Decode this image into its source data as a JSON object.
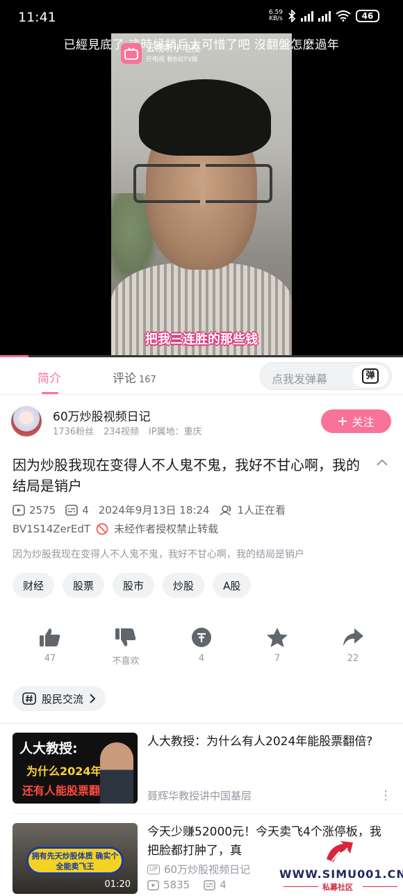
{
  "status_bar": {
    "time": "11:41",
    "net_speed": "6.59",
    "net_unit": "KB/s",
    "battery": "46"
  },
  "player": {
    "scrolling_danmaku": "已經見底了  這時候銷戶太可惜了吧  沒翻盤怎麼過年",
    "tv_badge_title": "云视听小电视",
    "tv_badge_sub": "开电视 看B站TV版",
    "subtitle": "把我三连胜的那些钱",
    "progress_fraction": 0.07
  },
  "tabs": {
    "intro_label": "简介",
    "comments_label": "评论",
    "comments_count": "167",
    "danmaku_placeholder": "点我发弹幕",
    "danmaku_button": "弹"
  },
  "uploader": {
    "name": "60万炒股视频日记",
    "fans": "1736粉丝",
    "videos": "234视频",
    "ip": "IP属地：重庆",
    "follow_label": "关注"
  },
  "video": {
    "title": "因为炒股我现在变得人不人鬼不鬼，我好不甘心啊，我的结局是销户",
    "plays": "2575",
    "danmaku_count": "4",
    "datetime": "2024年9月13日 18:24",
    "watching": "1人正在看",
    "bvid": "BV1S14ZerEdT",
    "copyright": "未经作者授权禁止转载",
    "description": "因为炒股我现在变得人不人鬼不鬼，我好不甘心啊，我的结局是销户",
    "tags": [
      "财经",
      "股票",
      "股市",
      "炒股",
      "A股"
    ]
  },
  "actions": {
    "like": "47",
    "dislike": "不喜欢",
    "coin": "4",
    "favorite": "7",
    "share": "22"
  },
  "community": {
    "label": "股民交流"
  },
  "recommendations": [
    {
      "title": "人大教授：为什么有人2024年能股票翻倍?",
      "author": "聂辉华教授讲中国基层",
      "thumb_line1": "人大教授:",
      "thumb_line2": "为什么2024年",
      "thumb_line3": "还有人能股票翻倍"
    },
    {
      "title": "今天少赚52000元！今天卖飞4个涨停板，我把脸都打肿了，真",
      "author": "60万炒股视频日记",
      "up_tag": "UP",
      "plays": "5835",
      "danmaku": "4",
      "duration": "01:20",
      "thumb_text": "拥有先天炒股体质 确实个全能卖飞王"
    }
  ],
  "watermark": {
    "site": "WWW.SIMU001.CN",
    "cn": "私募社区"
  },
  "colors": {
    "accent": "#fb7299",
    "text_secondary": "#9499a0"
  }
}
